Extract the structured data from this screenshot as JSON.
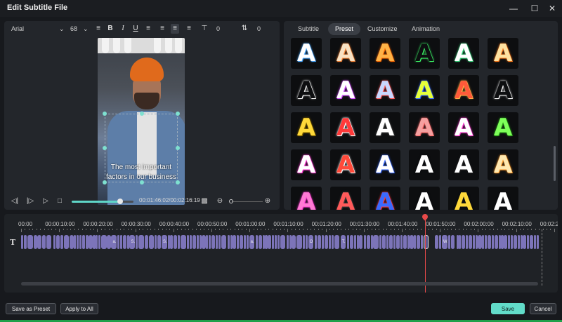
{
  "window": {
    "title": "Edit Subtitle File",
    "controls": [
      "minimize-icon",
      "maximize-icon",
      "close-icon"
    ]
  },
  "format_bar": {
    "font": "Arial",
    "size": "68",
    "bold": "B",
    "italic": "I",
    "underline": "U",
    "spacing_value": "0",
    "line_value": "0",
    "alignment_selected": "center"
  },
  "preview": {
    "subtitle_lines": [
      "The most important",
      "factors in our business"
    ]
  },
  "player": {
    "timecode": "00:01:46:02/00:02:16:19",
    "progress": 0.78,
    "zoom_level": 0.1
  },
  "tabs": [
    {
      "label": "Subtitle",
      "active": false
    },
    {
      "label": "Preset",
      "active": true
    },
    {
      "label": "Customize",
      "active": false
    },
    {
      "label": "Animation",
      "active": false
    }
  ],
  "presets": [
    {
      "glyph": "A",
      "color": "#ffffff",
      "glow": "#4aa8ff"
    },
    {
      "glyph": "A",
      "color": "#f8e2c4",
      "glow": "#ff8a3a"
    },
    {
      "glyph": "A",
      "color": "#ffb347",
      "glow": "#ff6a00"
    },
    {
      "glyph": "A",
      "color": "#0d0e10",
      "glow": "#3dff6a"
    },
    {
      "glyph": "A",
      "color": "#ffffff",
      "glow": "#37d47b"
    },
    {
      "glyph": "A",
      "color": "#ffe2a0",
      "glow": "#ff7a1a"
    },
    {
      "glyph": "A",
      "color": "#0d0e10",
      "glow": "#ffffff"
    },
    {
      "glyph": "A",
      "color": "#ffffff",
      "glow": "#d44aff"
    },
    {
      "glyph": "A",
      "color": "#c8d8ff",
      "glow": "#ff5a5a"
    },
    {
      "glyph": "A",
      "color": "#e6ff3a",
      "glow": "#3a6aff"
    },
    {
      "glyph": "A",
      "color": "#ff5a3a",
      "glow": "#ffb347"
    },
    {
      "glyph": "A",
      "color": "#0d0e10",
      "glow": "#ffffff"
    },
    {
      "glyph": "A",
      "color": "#ffd93a",
      "glow": "#8a6a00"
    },
    {
      "glyph": "A",
      "color": "#ff3a3a",
      "glow": "#ffffff"
    },
    {
      "glyph": "A",
      "color": "#ffffff",
      "glow": "#444444"
    },
    {
      "glyph": "A",
      "color": "#f5a0a0",
      "glow": "#ff6a6a"
    },
    {
      "glyph": "A",
      "color": "#ffffff",
      "glow": "#ff3ad4"
    },
    {
      "glyph": "A",
      "color": "#7eff5a",
      "glow": "#2a9a1a"
    },
    {
      "glyph": "A",
      "color": "#ffffff",
      "glow": "#ff3ad4"
    },
    {
      "glyph": "A",
      "color": "#ff4a3a",
      "glow": "#ffffff"
    },
    {
      "glyph": "A",
      "color": "#ffffff",
      "glow": "#3a6aff"
    },
    {
      "glyph": "A",
      "color": "#ffffff",
      "glow": "#0d0e10"
    },
    {
      "glyph": "A",
      "color": "#ffffff",
      "glow": "#222222"
    },
    {
      "glyph": "A",
      "color": "#ffe8b0",
      "glow": "#ff9a2a"
    },
    {
      "glyph": "A",
      "color": "#ff7ad4",
      "glow": "#ff3ad4"
    },
    {
      "glyph": "A",
      "color": "#ff5a5a",
      "glow": "#3a3a3a"
    },
    {
      "glyph": "A",
      "color": "#3a6aff",
      "glow": "#ff3a3a"
    },
    {
      "glyph": "A",
      "color": "#ffffff",
      "glow": "#0d0e10"
    },
    {
      "glyph": "A",
      "color": "#ffd93a",
      "glow": "#0d0e10"
    },
    {
      "glyph": "A",
      "color": "#ffffff",
      "glow": "#0d0e10"
    }
  ],
  "timeline": {
    "ticks": [
      "00:00",
      "00:00:10:00",
      "00:00:20:00",
      "00:00:30:00",
      "00:00:40:00",
      "00:00:50:00",
      "00:01:00:00",
      "00:01:10:00",
      "00:01:20:00",
      "00:01:30:00",
      "00:01:40:00",
      "00:01:50:00",
      "00:02:00:00",
      "00:02:10:00",
      "00:02:2"
    ],
    "track_icon": "T",
    "clips": [
      {
        "label": "",
        "start": 0.0,
        "len": 0.6
      },
      {
        "label": "",
        "start": 0.7,
        "len": 0.9
      },
      {
        "label": "",
        "start": 1.7,
        "len": 1.5
      },
      {
        "label": "",
        "start": 3.3,
        "len": 0.9
      },
      {
        "label": "",
        "start": 4.3,
        "len": 1.2
      },
      {
        "label": "",
        "start": 5.6,
        "len": 0.9
      },
      {
        "label": "",
        "start": 6.6,
        "len": 1.5
      },
      {
        "label": "",
        "start": 8.5,
        "len": 0.6
      },
      {
        "label": "",
        "start": 9.2,
        "len": 1.0
      },
      {
        "label": "",
        "start": 10.3,
        "len": 0.8
      },
      {
        "label": "",
        "start": 11.2,
        "len": 1.5
      },
      {
        "label": "",
        "start": 12.8,
        "len": 1.0
      },
      {
        "label": "",
        "start": 13.9,
        "len": 0.6
      },
      {
        "label": "",
        "start": 14.6,
        "len": 0.6
      },
      {
        "label": "",
        "start": 15.3,
        "len": 0.6
      },
      {
        "label": "",
        "start": 16.0,
        "len": 0.9
      },
      {
        "label": "",
        "start": 17.0,
        "len": 0.7
      },
      {
        "label": "",
        "start": 17.8,
        "len": 1.0
      },
      {
        "label": "",
        "start": 18.9,
        "len": 0.6
      },
      {
        "label": "",
        "start": 19.6,
        "len": 0.6
      },
      {
        "label": "",
        "start": 20.3,
        "len": 0.6
      },
      {
        "label": "",
        "start": 21.0,
        "len": 1.5
      },
      {
        "label": "",
        "start": 22.6,
        "len": 1.0
      },
      {
        "label": "a...",
        "start": 23.7,
        "len": 1.5
      },
      {
        "label": "",
        "start": 25.3,
        "len": 0.6
      },
      {
        "label": "",
        "start": 26.0,
        "len": 0.6
      },
      {
        "label": "",
        "start": 26.7,
        "len": 1.0
      },
      {
        "label": "",
        "start": 27.8,
        "len": 0.6
      },
      {
        "label": "S...",
        "start": 28.5,
        "len": 1.5
      },
      {
        "label": "",
        "start": 30.1,
        "len": 0.6
      },
      {
        "label": "",
        "start": 30.8,
        "len": 1.5
      },
      {
        "label": "",
        "start": 32.4,
        "len": 1.0
      },
      {
        "label": "",
        "start": 33.5,
        "len": 1.5
      },
      {
        "label": "",
        "start": 35.1,
        "len": 0.6
      },
      {
        "label": "",
        "start": 35.8,
        "len": 1.0
      },
      {
        "label": "S...",
        "start": 36.9,
        "len": 1.5
      },
      {
        "label": "",
        "start": 38.5,
        "len": 0.6
      },
      {
        "label": "",
        "start": 39.2,
        "len": 0.6
      },
      {
        "label": "",
        "start": 40.0,
        "len": 1.0
      },
      {
        "label": "",
        "start": 41.2,
        "len": 0.6
      },
      {
        "label": "",
        "start": 41.9,
        "len": 1.5
      },
      {
        "label": "",
        "start": 43.6,
        "len": 0.6
      },
      {
        "label": "",
        "start": 44.3,
        "len": 0.6
      },
      {
        "label": "",
        "start": 45.0,
        "len": 1.0
      },
      {
        "label": "",
        "start": 46.1,
        "len": 0.6
      },
      {
        "label": "",
        "start": 46.8,
        "len": 0.6
      },
      {
        "label": "",
        "start": 47.5,
        "len": 1.0
      },
      {
        "label": "",
        "start": 48.6,
        "len": 0.6
      },
      {
        "label": "",
        "start": 49.3,
        "len": 0.6
      },
      {
        "label": "",
        "start": 50.0,
        "len": 1.0
      },
      {
        "label": "",
        "start": 51.1,
        "len": 0.6
      },
      {
        "label": "",
        "start": 51.8,
        "len": 0.6
      },
      {
        "label": "",
        "start": 52.5,
        "len": 1.5
      },
      {
        "label": "",
        "start": 54.2,
        "len": 0.6
      },
      {
        "label": "",
        "start": 54.9,
        "len": 0.6
      },
      {
        "label": "",
        "start": 55.6,
        "len": 1.0
      },
      {
        "label": "",
        "start": 56.7,
        "len": 0.6
      },
      {
        "label": "",
        "start": 57.4,
        "len": 1.0
      },
      {
        "label": "",
        "start": 58.5,
        "len": 0.6
      },
      {
        "label": "",
        "start": 59.2,
        "len": 0.6
      },
      {
        "label": "a...",
        "start": 59.9,
        "len": 1.5
      },
      {
        "label": "",
        "start": 61.6,
        "len": 0.6
      },
      {
        "label": "",
        "start": 62.3,
        "len": 1.0
      },
      {
        "label": "",
        "start": 63.4,
        "len": 0.6
      },
      {
        "label": "",
        "start": 64.1,
        "len": 0.6
      },
      {
        "label": "",
        "start": 64.8,
        "len": 1.0
      },
      {
        "label": "",
        "start": 65.9,
        "len": 0.6
      },
      {
        "label": "",
        "start": 66.6,
        "len": 0.6
      },
      {
        "label": "",
        "start": 67.3,
        "len": 0.6
      },
      {
        "label": "",
        "start": 68.0,
        "len": 1.5
      },
      {
        "label": "",
        "start": 69.7,
        "len": 0.6
      },
      {
        "label": "",
        "start": 70.4,
        "len": 0.6
      },
      {
        "label": "",
        "start": 71.1,
        "len": 1.0
      },
      {
        "label": "",
        "start": 72.3,
        "len": 1.5
      },
      {
        "label": "",
        "start": 74.0,
        "len": 0.6
      },
      {
        "label": "",
        "start": 74.7,
        "len": 0.6
      },
      {
        "label": "O...",
        "start": 75.4,
        "len": 1.5
      },
      {
        "label": "",
        "start": 77.1,
        "len": 0.6
      },
      {
        "label": "",
        "start": 77.8,
        "len": 1.0
      },
      {
        "label": "",
        "start": 79.0,
        "len": 0.6
      },
      {
        "label": "",
        "start": 79.7,
        "len": 1.0
      },
      {
        "label": "",
        "start": 80.8,
        "len": 0.6
      },
      {
        "label": "",
        "start": 81.5,
        "len": 0.6
      },
      {
        "label": "",
        "start": 82.2,
        "len": 1.5
      },
      {
        "label": "T...",
        "start": 83.9,
        "len": 1.5
      },
      {
        "label": "",
        "start": 85.6,
        "len": 0.6
      },
      {
        "label": "",
        "start": 86.3,
        "len": 1.0
      },
      {
        "label": "",
        "start": 87.4,
        "len": 0.6
      },
      {
        "label": "",
        "start": 88.1,
        "len": 0.6
      },
      {
        "label": "",
        "start": 88.8,
        "len": 1.0
      },
      {
        "label": "",
        "start": 90.0,
        "len": 0.6
      },
      {
        "label": "",
        "start": 90.7,
        "len": 1.0
      },
      {
        "label": "",
        "start": 91.8,
        "len": 0.6
      },
      {
        "label": "",
        "start": 92.5,
        "len": 1.5
      },
      {
        "label": "",
        "start": 94.1,
        "len": 0.6
      },
      {
        "label": "",
        "start": 94.8,
        "len": 1.0
      },
      {
        "label": "",
        "start": 96.0,
        "len": 0.6
      },
      {
        "label": "",
        "start": 96.7,
        "len": 1.0
      },
      {
        "label": "",
        "start": 97.8,
        "len": 0.6
      },
      {
        "label": "",
        "start": 98.5,
        "len": 1.0
      },
      {
        "label": "",
        "start": 99.6,
        "len": 0.6
      },
      {
        "label": "",
        "start": 100.3,
        "len": 1.0
      },
      {
        "label": "",
        "start": 101.4,
        "len": 0.6
      },
      {
        "label": "",
        "start": 102.1,
        "len": 1.0
      },
      {
        "label": "",
        "start": 103.2,
        "len": 0.6
      },
      {
        "label": "",
        "start": 103.9,
        "len": 1.0
      },
      {
        "label": "",
        "start": 105.0,
        "len": 0.6
      },
      {
        "label": "",
        "start": 105.7,
        "len": 1.4,
        "selected": true
      },
      {
        "label": "",
        "start": 108.6,
        "len": 1.0
      },
      {
        "label": "",
        "start": 109.7,
        "len": 0.6
      },
      {
        "label": "W...",
        "start": 110.5,
        "len": 1.5
      },
      {
        "label": "",
        "start": 112.2,
        "len": 0.6
      },
      {
        "label": "",
        "start": 112.9,
        "len": 1.0
      },
      {
        "label": "",
        "start": 114.3,
        "len": 0.6
      },
      {
        "label": "",
        "start": 115.0,
        "len": 0.6
      },
      {
        "label": "",
        "start": 115.7,
        "len": 1.0
      },
      {
        "label": "",
        "start": 116.8,
        "len": 0.6
      },
      {
        "label": "",
        "start": 117.5,
        "len": 1.0
      },
      {
        "label": "",
        "start": 118.6,
        "len": 0.6
      },
      {
        "label": "",
        "start": 119.3,
        "len": 0.6
      },
      {
        "label": "",
        "start": 120.0,
        "len": 1.0
      },
      {
        "label": "",
        "start": 121.1,
        "len": 0.6
      },
      {
        "label": "",
        "start": 121.8,
        "len": 0.6
      },
      {
        "label": "",
        "start": 122.5,
        "len": 1.0
      },
      {
        "label": "",
        "start": 123.6,
        "len": 0.6
      },
      {
        "label": "",
        "start": 124.3,
        "len": 1.0
      },
      {
        "label": "",
        "start": 125.4,
        "len": 0.6
      },
      {
        "label": "",
        "start": 126.1,
        "len": 0.6
      },
      {
        "label": "",
        "start": 126.8,
        "len": 1.0
      },
      {
        "label": "",
        "start": 127.9,
        "len": 0.6
      },
      {
        "label": "",
        "start": 128.6,
        "len": 0.6
      },
      {
        "label": "",
        "start": 129.3,
        "len": 1.0
      },
      {
        "label": "",
        "start": 130.4,
        "len": 0.6
      },
      {
        "label": "",
        "start": 131.1,
        "len": 0.6
      },
      {
        "label": "",
        "start": 131.8,
        "len": 1.0
      },
      {
        "label": "",
        "start": 132.9,
        "len": 0.6
      },
      {
        "label": "",
        "start": 133.6,
        "len": 1.0
      },
      {
        "label": "",
        "start": 134.7,
        "len": 0.6
      },
      {
        "label": "",
        "start": 135.4,
        "len": 0.6
      }
    ],
    "playhead_seconds": 106.1,
    "end_seconds": 136.8
  },
  "footer": {
    "save_as_preset": "Save as Preset",
    "apply_to_all": "Apply to All",
    "save": "Save",
    "cancel": "Cancel"
  }
}
